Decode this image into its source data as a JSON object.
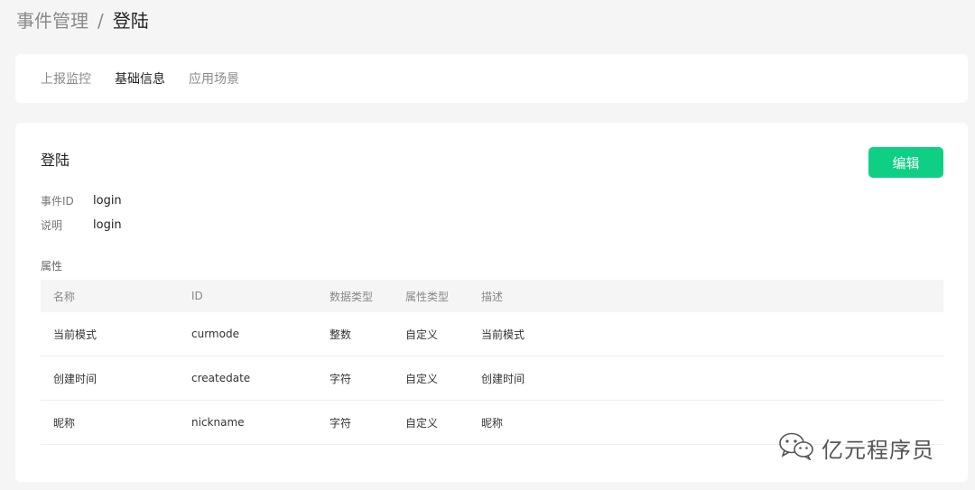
{
  "breadcrumb": {
    "parent": "事件管理",
    "separator": "/",
    "current": "登陆"
  },
  "tabs": [
    {
      "label": "上报监控",
      "active": false
    },
    {
      "label": "基础信息",
      "active": true
    },
    {
      "label": "应用场景",
      "active": false
    }
  ],
  "event": {
    "title": "登陆",
    "edit_label": "编辑",
    "id_label": "事件ID",
    "id_value": "login",
    "desc_label": "说明",
    "desc_value": "login"
  },
  "attributes": {
    "section_label": "属性",
    "headers": [
      "名称",
      "ID",
      "数据类型",
      "属性类型",
      "描述"
    ],
    "rows": [
      [
        "当前模式",
        "curmode",
        "整数",
        "自定义",
        "当前模式"
      ],
      [
        "创建时间",
        "createdate",
        "字符",
        "自定义",
        "创建时间"
      ],
      [
        "昵称",
        "nickname",
        "字符",
        "自定义",
        "昵称"
      ]
    ]
  },
  "watermark": {
    "text": "亿元程序员",
    "icon": "wechat-icon"
  },
  "colors": {
    "accent": "#0fcf85",
    "background": "#f5f5f5"
  }
}
